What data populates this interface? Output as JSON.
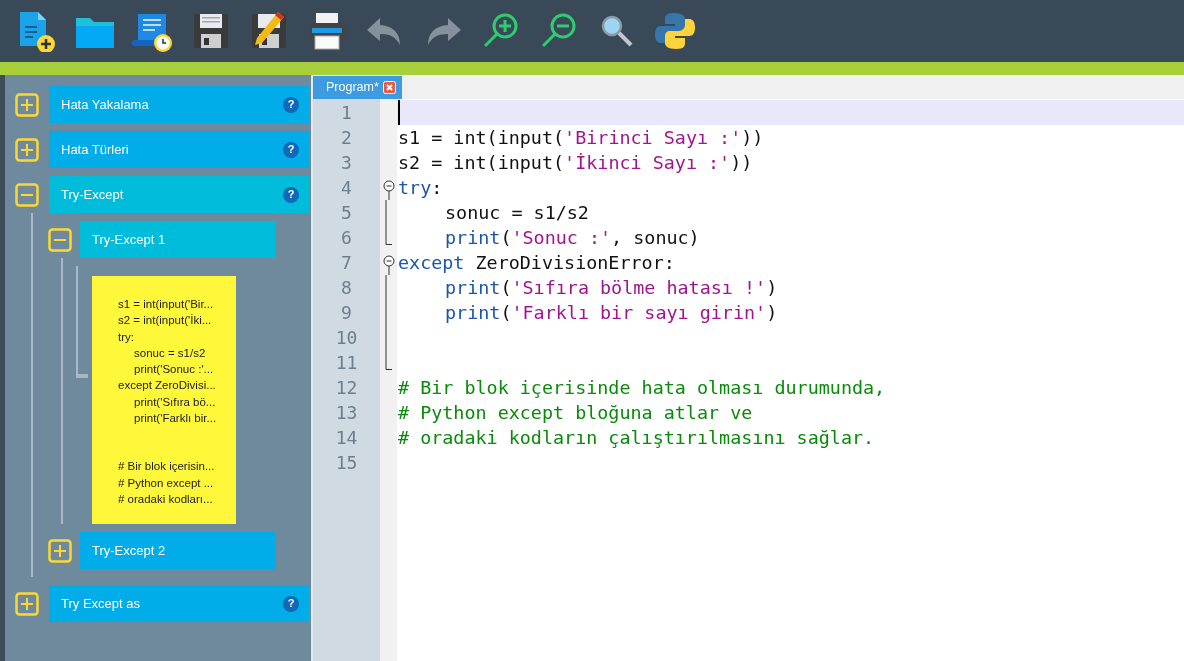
{
  "toolbar": [
    {
      "kind": "new",
      "disabled": false
    },
    {
      "kind": "open",
      "disabled": false
    },
    {
      "kind": "history",
      "disabled": false
    },
    {
      "kind": "save",
      "disabled": false
    },
    {
      "kind": "save_as",
      "disabled": false
    },
    {
      "kind": "print",
      "disabled": false
    },
    {
      "kind": "undo",
      "disabled": true
    },
    {
      "kind": "redo",
      "disabled": true
    },
    {
      "kind": "zoom_in",
      "disabled": false
    },
    {
      "kind": "zoom_out",
      "disabled": false
    },
    {
      "kind": "search",
      "disabled": false
    },
    {
      "kind": "run",
      "disabled": false
    }
  ],
  "sidebar": {
    "items": [
      {
        "label": "Hata Yakalama",
        "expanded": false,
        "help": "?"
      },
      {
        "label": "Hata Türleri",
        "expanded": false,
        "help": "?"
      },
      {
        "label": "Try-Except",
        "expanded": true,
        "help": "?",
        "children": [
          {
            "label": "Try-Except 1",
            "expanded": true,
            "note": {
              "blocks": [
                [
                  {
                    "text": "s1 = int(input('Bir...",
                    "indented": false
                  },
                  {
                    "text": "s2 = int(input('İki...",
                    "indented": false
                  },
                  {
                    "text": "try:",
                    "indented": false
                  },
                  {
                    "text": "sonuc = s1/s2",
                    "indented": true
                  },
                  {
                    "text": "print('Sonuc :'...",
                    "indented": true
                  },
                  {
                    "text": "except ZeroDivisi...",
                    "indented": false
                  },
                  {
                    "text": "print('Sıfıra bö...",
                    "indented": true
                  },
                  {
                    "text": "print('Farklı bir...",
                    "indented": true
                  }
                ],
                [
                  {
                    "text": "# Bir blok içerisin...",
                    "indented": false
                  },
                  {
                    "text": "# Python except ...",
                    "indented": false
                  },
                  {
                    "text": "# oradaki kodları...",
                    "indented": false
                  }
                ]
              ]
            }
          },
          {
            "label": "Try-Except 2",
            "expanded": false
          }
        ]
      },
      {
        "label": "Try Except as",
        "expanded": false,
        "help": "?"
      }
    ]
  },
  "editor": {
    "tabs": [
      {
        "label": "Program*",
        "selected": true
      }
    ],
    "lines": [
      {
        "number": "1",
        "current": true,
        "kind": "plain"
      },
      {
        "number": "2",
        "current": false,
        "kind": "plain",
        "tokens": [
          {
            "kind": "plain",
            "text": "s1 = int(input("
          },
          {
            "kind": "string",
            "text": "'Birinci Sayı :'"
          },
          {
            "kind": "plain",
            "text": "))"
          }
        ]
      },
      {
        "number": "3",
        "current": false,
        "kind": "plain",
        "tokens": [
          {
            "kind": "plain",
            "text": "s2 = int(input("
          },
          {
            "kind": "string",
            "text": "'İkinci Sayı :'"
          },
          {
            "kind": "plain",
            "text": "))"
          }
        ]
      },
      {
        "number": "4",
        "current": false,
        "kind": "fold_start",
        "tokens": [
          {
            "kind": "keyword",
            "text": "try"
          },
          {
            "kind": "plain",
            "text": ":"
          }
        ]
      },
      {
        "number": "5",
        "current": false,
        "kind": "fold_body",
        "indented": true,
        "tokens": [
          {
            "kind": "plain",
            "text": "sonuc = s1/s2"
          }
        ]
      },
      {
        "number": "6",
        "current": false,
        "kind": "fold_end",
        "indented": true,
        "tokens": [
          {
            "kind": "keyword",
            "text": "print"
          },
          {
            "kind": "plain",
            "text": "("
          },
          {
            "kind": "string",
            "text": "'Sonuc :'"
          },
          {
            "kind": "plain",
            "text": ", sonuc)"
          }
        ]
      },
      {
        "number": "7",
        "current": false,
        "kind": "fold_start",
        "tokens": [
          {
            "kind": "keyword",
            "text": "except"
          },
          {
            "kind": "plain",
            "text": " ZeroDivisionError:"
          }
        ]
      },
      {
        "number": "8",
        "current": false,
        "kind": "fold_body",
        "indented": true,
        "tokens": [
          {
            "kind": "keyword",
            "text": "print"
          },
          {
            "kind": "plain",
            "text": "("
          },
          {
            "kind": "string",
            "text": "'Sıfıra bölme hatası !'"
          },
          {
            "kind": "plain",
            "text": ")"
          }
        ]
      },
      {
        "number": "9",
        "current": false,
        "kind": "fold_body",
        "indented": true,
        "tokens": [
          {
            "kind": "keyword",
            "text": "print"
          },
          {
            "kind": "plain",
            "text": "("
          },
          {
            "kind": "string",
            "text": "'Farklı bir sayı girin'"
          },
          {
            "kind": "plain",
            "text": ")"
          }
        ]
      },
      {
        "number": "10",
        "current": false,
        "kind": "fold_body"
      },
      {
        "number": "11",
        "current": false,
        "kind": "fold_end"
      },
      {
        "number": "12",
        "current": false,
        "kind": "plain",
        "tokens": [
          {
            "kind": "comment",
            "text": "# Bir blok içerisinde hata olması durumunda,"
          }
        ]
      },
      {
        "number": "13",
        "current": false,
        "kind": "plain",
        "tokens": [
          {
            "kind": "comment",
            "text": "# Python except bloğuna atlar ve"
          }
        ]
      },
      {
        "number": "14",
        "current": false,
        "kind": "plain",
        "tokens": [
          {
            "kind": "comment",
            "text": "# oradaki kodların çalıştırılmasını sağlar."
          }
        ]
      },
      {
        "number": "15",
        "current": false,
        "kind": "plain"
      }
    ]
  }
}
